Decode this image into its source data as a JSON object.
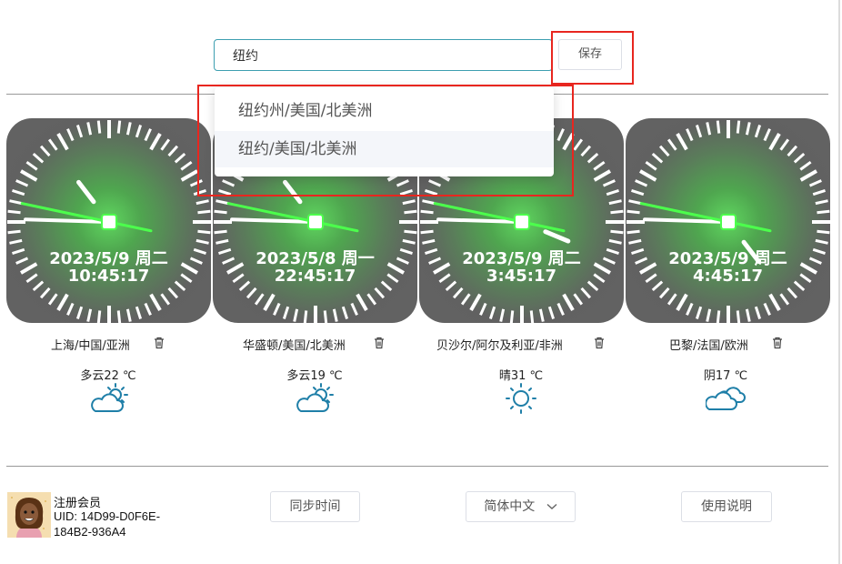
{
  "search": {
    "value": "纽约",
    "save_label": "保存"
  },
  "dropdown": {
    "options": [
      "纽约州/美国/北美洲",
      "纽约/美国/北美洲"
    ],
    "highlighted_index": 1
  },
  "clocks": [
    {
      "date": "2023/5/9 周二",
      "time": "10:45:17",
      "city": "上海/中国/亚洲",
      "weather": "多云22 ℃",
      "weather_icon": "partly-cloudy-icon"
    },
    {
      "date": "2023/5/8 周一",
      "time": "22:45:17",
      "city": "华盛顿/美国/北美洲",
      "weather": "多云19 ℃",
      "weather_icon": "partly-cloudy-icon"
    },
    {
      "date": "2023/5/9 周二",
      "time": "3:45:17",
      "city": "贝沙尔/阿尔及利亚/非洲",
      "weather": "晴31 ℃",
      "weather_icon": "sunny-icon"
    },
    {
      "date": "2023/5/9 周二",
      "time": "4:45:17",
      "city": "巴黎/法国/欧洲",
      "weather": "阴17 ℃",
      "weather_icon": "cloudy-icon"
    }
  ],
  "footer": {
    "member_title": "注册会员",
    "uid_line1": "UID: 14D99-D0F6E-",
    "uid_line2": "184B2-936A4",
    "sync_label": "同步时间",
    "language_label": "简体中文",
    "help_label": "使用说明"
  },
  "colors": {
    "accent_input_border": "#3d9fb0",
    "highlight_red": "#e8261f",
    "second_hand": "#4cff4c",
    "weather_icon_blue": "#1f7fa8"
  }
}
